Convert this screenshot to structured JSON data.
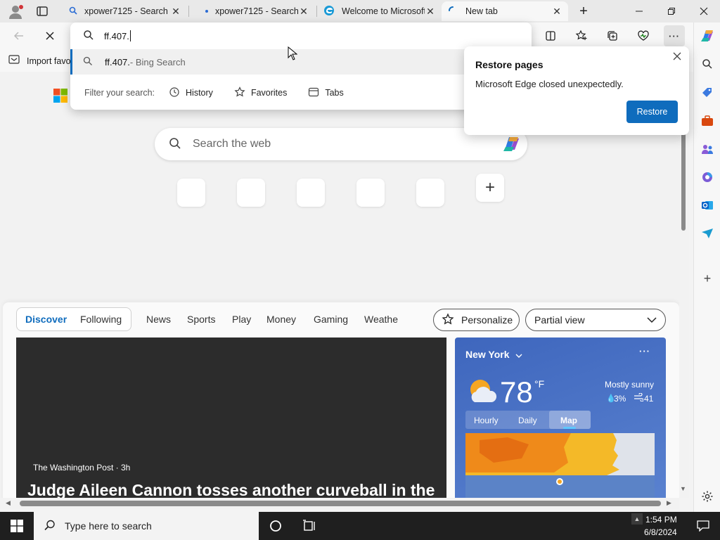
{
  "tabs": [
    {
      "title": "xpower7125 - Search"
    },
    {
      "title": "xpower7125 - Search"
    },
    {
      "title": "Welcome to Microsoft"
    },
    {
      "title": "New tab"
    }
  ],
  "address_bar": {
    "value": "ff.407."
  },
  "favorites_bar": {
    "import_label": "Import favo"
  },
  "suggestions": {
    "items": [
      {
        "query": "ff.407.",
        "suffix": " - Bing Search"
      }
    ],
    "filter_label": "Filter your search:",
    "filters": [
      "History",
      "Favorites",
      "Tabs"
    ]
  },
  "restore_popup": {
    "title": "Restore pages",
    "message": "Microsoft Edge closed unexpectedly.",
    "button": "Restore"
  },
  "newtab": {
    "search_placeholder": "Search the web"
  },
  "feed": {
    "tabs": [
      "Discover",
      "Following",
      "News",
      "Sports",
      "Play",
      "Money",
      "Gaming",
      "Weathe"
    ],
    "personalize": "Personalize",
    "view_select": "Partial view",
    "article": {
      "source": "The Washington Post · 3h",
      "headline": "Judge Aileen Cannon tosses another curveball in the"
    }
  },
  "weather": {
    "location": "New York",
    "temp": "78",
    "unit": "°F",
    "condition": "Mostly sunny",
    "precip": "3%",
    "wind": "41",
    "tabs": [
      "Hourly",
      "Daily",
      "Map"
    ],
    "active_tab": "Map"
  },
  "taskbar": {
    "search_placeholder": "Type here to search",
    "time": "1:54 PM",
    "date": "6/8/2024"
  },
  "colors": {
    "accent": "#0067c0",
    "edge_blue": "#0f6cbd",
    "weather_bg": "#4a72c4",
    "taskbar": "#1f1f1f"
  }
}
